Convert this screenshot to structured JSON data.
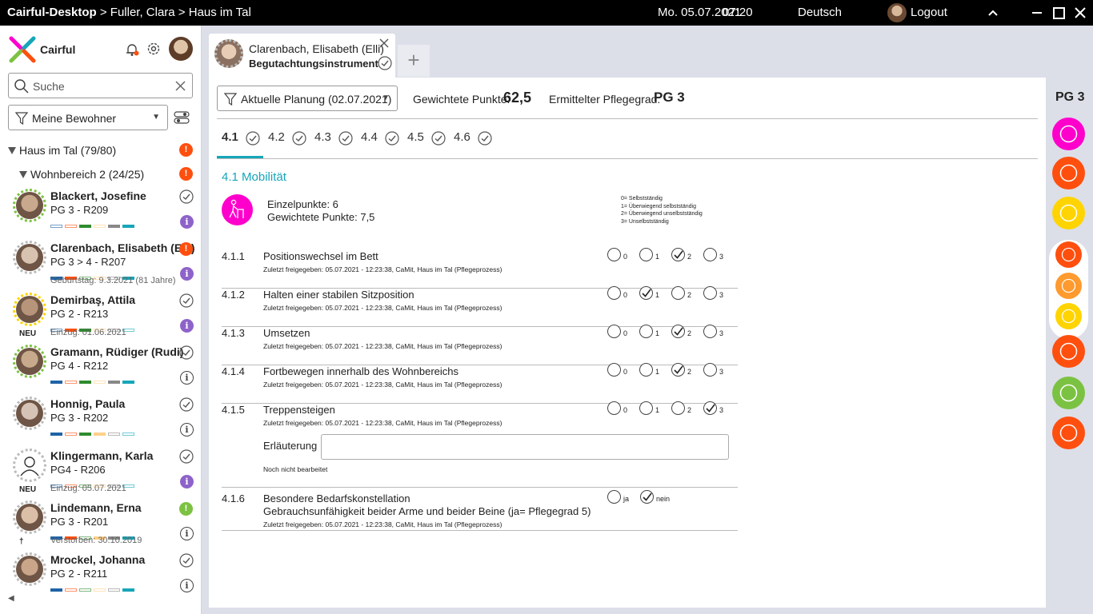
{
  "titlebar": {
    "app": "Cairful-Desktop",
    "crumb_rest": " > Fuller, Clara > Haus im Tal",
    "date": "Mo. 05.07.2021",
    "time": "07:20",
    "language": "Deutsch",
    "logout": "Logout"
  },
  "sidebar": {
    "logo_text": "Cairful",
    "search_placeholder": "Suche",
    "filter_value": "Meine Bewohner",
    "tree": {
      "house": "Haus im Tal (79/80)",
      "area": "Wohnbereich 2 (24/25)",
      "badge": "!"
    },
    "residents": [
      {
        "name": "Blackert, Josefine",
        "pg": "PG 3 - R209",
        "sub": "",
        "neu": "",
        "status": "check",
        "info": "filled"
      },
      {
        "name": "Clarenbach, Elisabeth (Elli)",
        "pg": "PG 3 > 4 - R207",
        "sub": "Geburtstag: 9.3.2021 (81 Jahre)",
        "neu": "",
        "status": "alert",
        "info": "filled"
      },
      {
        "name": "Demirbaş, Attila",
        "pg": "PG 2 - R213",
        "sub": "Einzug: 01.06.2021",
        "neu": "NEU",
        "status": "check",
        "info": "filled"
      },
      {
        "name": "Gramann, Rüdiger (Rudi)",
        "pg": "PG 4 - R212",
        "sub": "",
        "neu": "",
        "status": "check",
        "info": "outline"
      },
      {
        "name": "Honnig, Paula",
        "pg": "PG 3 - R202",
        "sub": "",
        "neu": "",
        "status": "check",
        "info": "outline"
      },
      {
        "name": "Klingermann, Karla",
        "pg": "PG4 - R206",
        "sub": "Einzug: 05.07.2021",
        "neu": "NEU",
        "status": "check",
        "info": "filled"
      },
      {
        "name": "Lindemann, Erna",
        "pg": "PG 3 - R201",
        "sub": "Verstorben: 30.10.2019",
        "neu": "†",
        "status": "green",
        "info": "outline"
      },
      {
        "name": "Mrockel, Johanna",
        "pg": "PG 2 - R211",
        "sub": "",
        "neu": "",
        "status": "check",
        "info": "outline"
      }
    ]
  },
  "tab": {
    "name": "Clarenbach, Elisabeth (Elli)",
    "subtitle": "Begutachtungsinstrument",
    "add": "+"
  },
  "header": {
    "plan": "Aktuelle Planung (02.07.2021)",
    "gp_label": "Gewichtete Punkte:",
    "gp_value": "62,5",
    "pg_label": "Ermittelter Pflegegrad:",
    "pg_value": "PG 3"
  },
  "section_tabs": [
    "4.1",
    "4.2",
    "4.3",
    "4.4",
    "4.5",
    "4.6"
  ],
  "section": {
    "title": "4.1 Mobilität",
    "einzel": "Einzelpunkte: 6",
    "gewichtet": "Gewichtete Punkte: 7,5",
    "legend": [
      "0= Selbstständig",
      "1= Überwiegend selbstständig",
      "2= Überwiegend unselbstständig",
      "3= Unselbstständig"
    ]
  },
  "items": [
    {
      "num": "4.1.1",
      "title": "Positionswechsel im Bett",
      "meta": "Zuletzt freigegeben: 05.07.2021 - 12:23:38, CaMit, Haus im Tal (Pflegeprozess)",
      "selected": 2
    },
    {
      "num": "4.1.2",
      "title": "Halten einer stabilen Sitzposition",
      "meta": "Zuletzt freigegeben: 05.07.2021 - 12:23:38, CaMit, Haus im Tal (Pflegeprozess)",
      "selected": 1
    },
    {
      "num": "4.1.3",
      "title": "Umsetzen",
      "meta": "Zuletzt freigegeben: 05.07.2021 - 12:23:38, CaMit, Haus im Tal (Pflegeprozess)",
      "selected": 2
    },
    {
      "num": "4.1.4",
      "title": "Fortbewegen innerhalb des Wohnbereichs",
      "meta": "Zuletzt freigegeben: 05.07.2021 - 12:23:38, CaMit, Haus im Tal (Pflegeprozess)",
      "selected": 2
    },
    {
      "num": "4.1.5",
      "title": "Treppensteigen",
      "meta": "Zuletzt freigegeben: 05.07.2021 - 12:23:38, CaMit, Haus im Tal (Pflegeprozess)",
      "selected": 3
    }
  ],
  "option_labels": [
    "0",
    "1",
    "2",
    "3"
  ],
  "erlaeuterung": {
    "label": "Erläuterung",
    "value": "",
    "status": "Noch nicht bearbeitet"
  },
  "special": {
    "num": "4.1.6",
    "title": "Besondere Bedarfskonstellation",
    "title2": "Gebrauchsunfähigkeit beider Arme und beider Beine (ja= Pflegegrad 5)",
    "meta": "Zuletzt freigegeben: 05.07.2021 - 12:23:38, CaMit, Haus im Tal (Pflegeprozess)",
    "yes": "ja",
    "no": "nein",
    "selected": "nein"
  },
  "rightbar": {
    "pg": "PG 3",
    "modules": [
      {
        "name": "mobility-icon",
        "color": "#ff00cc"
      },
      {
        "name": "brain-icon",
        "color": "#ff4f0f"
      },
      {
        "name": "smiley-icon",
        "color": "#ffd400"
      },
      {
        "name": "shirt-icon",
        "color": "#ff4f0f"
      },
      {
        "name": "washing-icon",
        "color": "#ff9a2e"
      },
      {
        "name": "cutlery-icon",
        "color": "#ffd400"
      },
      {
        "name": "person-icon",
        "color": "#ff4f0f"
      },
      {
        "name": "heart-icon",
        "color": "#7cc242"
      },
      {
        "name": "social-icon",
        "color": "#ff4f0f"
      }
    ]
  }
}
